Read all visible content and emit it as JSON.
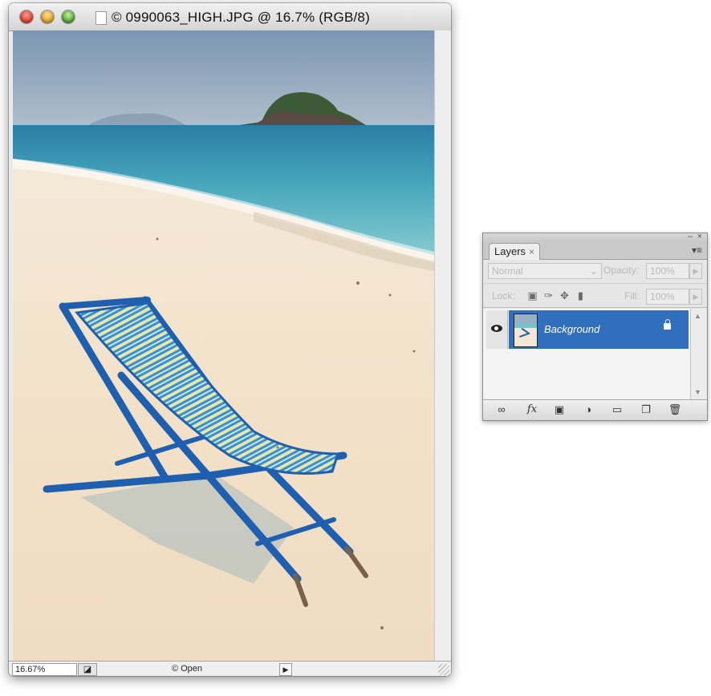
{
  "document_window": {
    "title": "© 0990063_HIGH.JPG @ 16.7% (RGB/8)",
    "status_bar": {
      "zoom": "16.67%",
      "info": "© Open"
    }
  },
  "layers_panel": {
    "tab_label": "Layers",
    "blend_mode": "Normal",
    "opacity_label": "Opacity:",
    "opacity_value": "100%",
    "lock_label": "Lock:",
    "fill_label": "Fill:",
    "fill_value": "100%",
    "layers": [
      {
        "name": "Background",
        "visible": true,
        "locked": true,
        "selected": true
      }
    ],
    "bottom_icons": [
      "link-icon",
      "fx-icon",
      "mask-icon",
      "adjustment-icon",
      "group-icon",
      "new-layer-icon",
      "trash-icon"
    ]
  },
  "colors": {
    "selection": "#2f6fbe",
    "chair_blue": "#1f5fb0",
    "sea": "#2e8fb0",
    "sand": "#f3e5d1"
  }
}
